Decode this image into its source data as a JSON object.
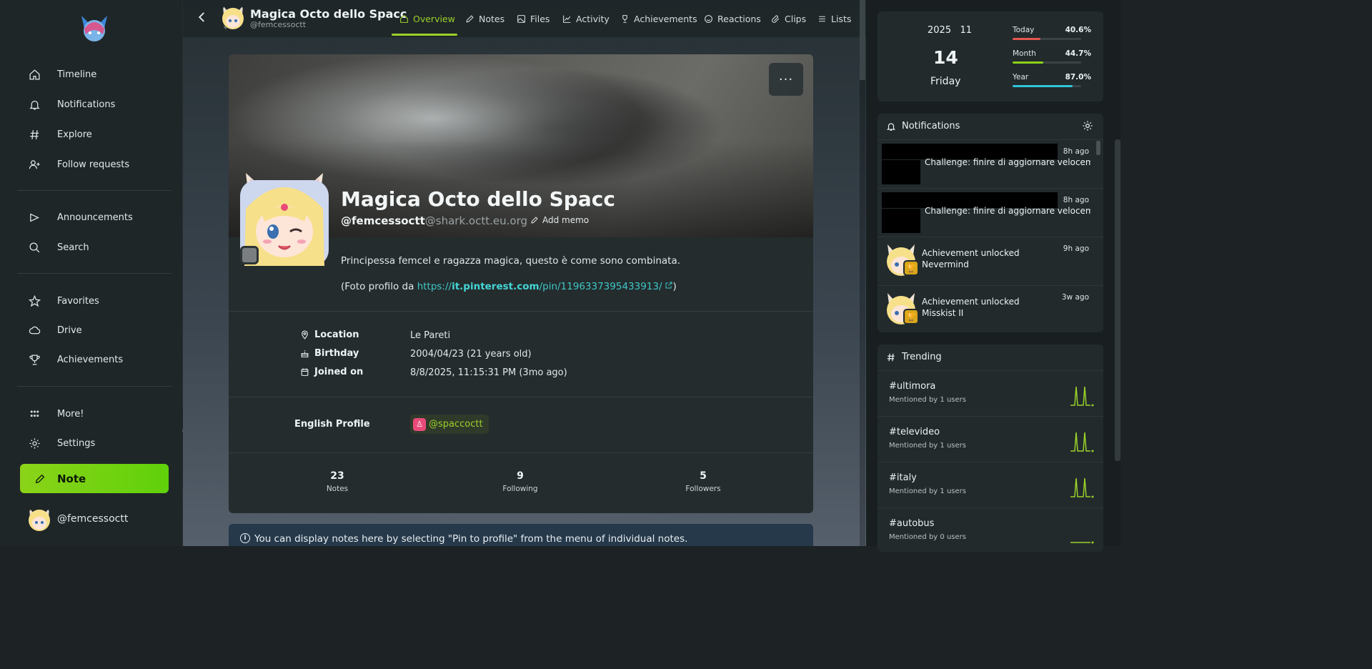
{
  "sidebar": {
    "items_top": [
      {
        "label": "Timeline",
        "icon": "home-icon"
      },
      {
        "label": "Notifications",
        "icon": "bell-icon"
      },
      {
        "label": "Explore",
        "icon": "hash-icon"
      },
      {
        "label": "Follow requests",
        "icon": "user-plus-icon"
      }
    ],
    "items_mid": [
      {
        "label": "Announcements",
        "icon": "megaphone-icon"
      },
      {
        "label": "Search",
        "icon": "search-icon"
      }
    ],
    "items_low": [
      {
        "label": "Favorites",
        "icon": "star-icon"
      },
      {
        "label": "Drive",
        "icon": "cloud-icon"
      },
      {
        "label": "Achievements",
        "icon": "trophy-icon"
      }
    ],
    "items_bottom": [
      {
        "label": "More!",
        "icon": "grid-dots-icon"
      },
      {
        "label": "Settings",
        "icon": "gear-icon"
      }
    ],
    "note_label": "Note",
    "account_handle": "@femcessoctt"
  },
  "topbar": {
    "title": "Magica Octo dello Spacc",
    "handle": "@femcessoctt",
    "tabs": [
      {
        "label": "Overview",
        "icon": "home-icon",
        "active": true
      },
      {
        "label": "Notes",
        "icon": "pencil-icon"
      },
      {
        "label": "Files",
        "icon": "image-icon"
      },
      {
        "label": "Activity",
        "icon": "chart-line-icon"
      },
      {
        "label": "Achievements",
        "icon": "trophy-icon"
      },
      {
        "label": "Reactions",
        "icon": "smile-icon"
      },
      {
        "label": "Clips",
        "icon": "paperclip-icon"
      },
      {
        "label": "Lists",
        "icon": "list-icon"
      }
    ]
  },
  "profile": {
    "menu_label": "···",
    "name": "Magica Octo dello Spacc",
    "username": "@femcessoctt",
    "host": "@shark.octt.eu.org",
    "add_memo": "Add memo",
    "bio_line1": "Principessa femcel e ragazza magica, questo è come sono combinata.",
    "bio_line2_prefix": "(Foto profilo da ",
    "bio_link_scheme": "https://",
    "bio_link_domain": "it.pinterest.com",
    "bio_link_path": "/pin/1196337395433913/",
    "bio_line2_suffix": ")",
    "fields": [
      {
        "key": "Location",
        "value": "Le Pareti",
        "icon": "map-pin-icon"
      },
      {
        "key": "Birthday",
        "value": "2004/04/23 (21 years old)",
        "icon": "cake-icon"
      },
      {
        "key": "Joined on",
        "value": "8/8/2025, 11:15:31 PM (3mo ago)",
        "icon": "calendar-icon"
      }
    ],
    "english_profile_key": "English Profile",
    "english_profile_value": "@spaccoctt",
    "stats": [
      {
        "value": "23",
        "label": "Notes"
      },
      {
        "value": "9",
        "label": "Following"
      },
      {
        "value": "5",
        "label": "Followers"
      }
    ],
    "pin_info": "You can display notes here by selecting \"Pin to profile\" from the menu of individual notes."
  },
  "clock": {
    "year": "2025",
    "month": "11",
    "day": "14",
    "weekday": "Friday",
    "progress": [
      {
        "label": "Today",
        "value": "40.6%",
        "fraction": 0.406,
        "color": "#e5574f"
      },
      {
        "label": "Month",
        "value": "44.7%",
        "fraction": 0.447,
        "color": "#8ed11a"
      },
      {
        "label": "Year",
        "value": "87.0%",
        "fraction": 0.87,
        "color": "#2fc6d6"
      }
    ]
  },
  "notifications": {
    "title": "Notifications",
    "items": [
      {
        "time": "8h ago",
        "text": "Challenge: finire di aggiornare velocem"
      },
      {
        "time": "8h ago",
        "text": "Challenge: finire di aggiornare velocem"
      },
      {
        "time": "9h ago",
        "title": "Achievement unlocked",
        "subtitle": "Nevermind"
      },
      {
        "time": "3w ago",
        "title": "Achievement unlocked",
        "subtitle": "Misskist II"
      }
    ]
  },
  "trending": {
    "title": "Trending",
    "items": [
      {
        "tag": "#ultimora",
        "sub": "Mentioned by 1 users"
      },
      {
        "tag": "#televideo",
        "sub": "Mentioned by 1 users"
      },
      {
        "tag": "#italy",
        "sub": "Mentioned by 1 users"
      },
      {
        "tag": "#autobus",
        "sub": "Mentioned by 0 users"
      }
    ]
  },
  "colors": {
    "accent": "#9bd12a",
    "link": "#3fc6c6"
  }
}
